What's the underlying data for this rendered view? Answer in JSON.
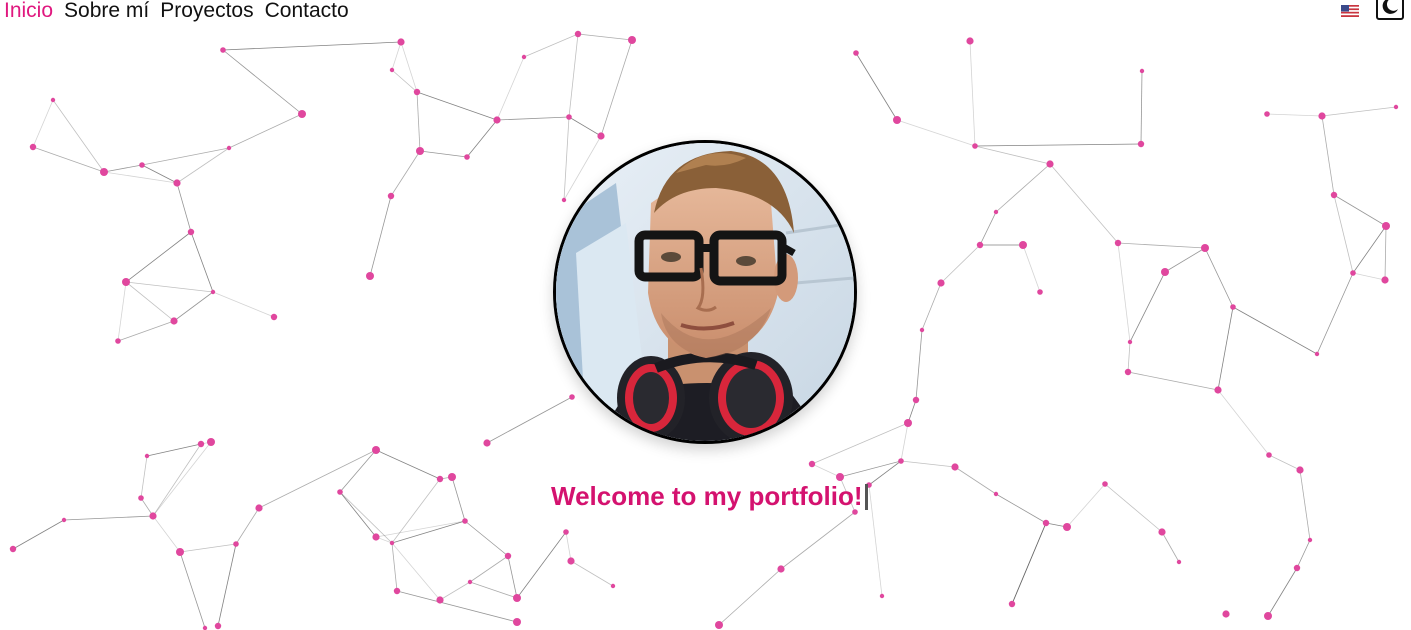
{
  "nav": {
    "items": [
      {
        "label": "Inicio",
        "active": true
      },
      {
        "label": "Sobre mí",
        "active": false
      },
      {
        "label": "Proyectos",
        "active": false
      },
      {
        "label": "Contacto",
        "active": false
      }
    ]
  },
  "toolbar": {
    "language_icon": "us-flag-icon",
    "theme_icon": "moon-icon"
  },
  "hero": {
    "avatar_icon": "profile-photo",
    "welcome_text": "Welcome to my portfolio!"
  },
  "colors": {
    "accent": "#e0187f",
    "node": "#e0479e",
    "edge": "#555555",
    "background": "#ffffff"
  }
}
